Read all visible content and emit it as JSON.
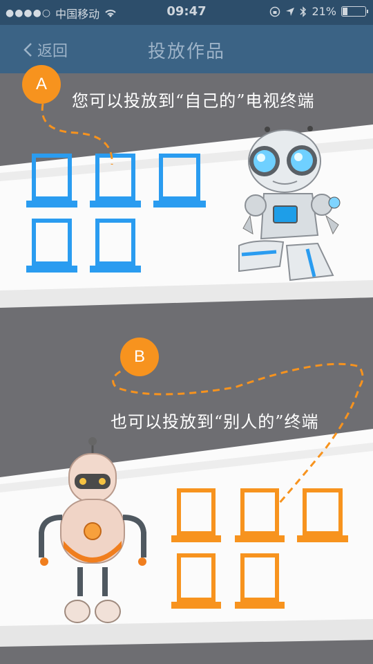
{
  "status_bar": {
    "carrier": "中国移动",
    "time": "09:47",
    "battery": "21%",
    "battery_level": 0.21
  },
  "nav": {
    "back_label": "返回",
    "title": "投放作品"
  },
  "section_a": {
    "badge": "A",
    "caption": "您可以投放到“自己的”电视终端",
    "terminal_color": "#2a9cf0"
  },
  "section_b": {
    "badge": "B",
    "caption": "也可以投放到“别人的”终端",
    "terminal_color": "#f7931e"
  }
}
